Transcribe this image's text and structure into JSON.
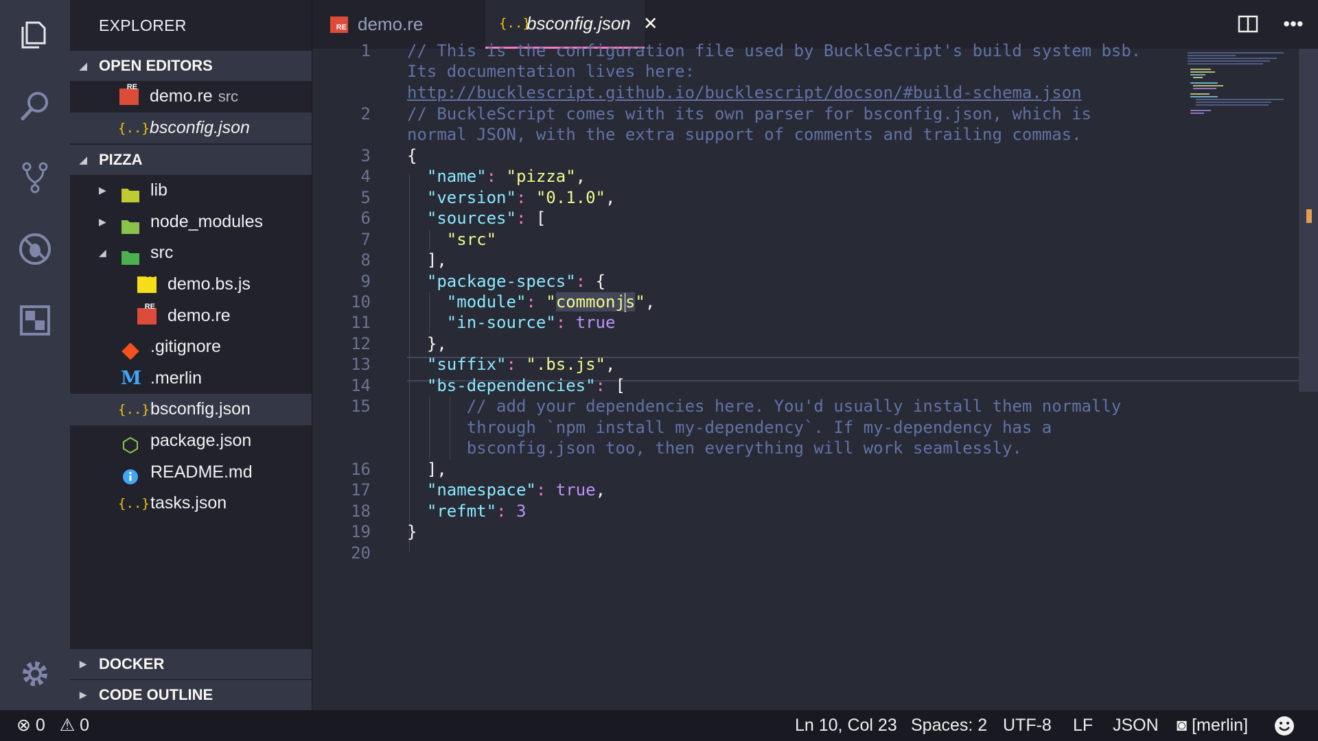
{
  "sidebar": {
    "title": "EXPLORER",
    "open_editors": {
      "label": "OPEN EDITORS",
      "items": [
        {
          "name": "demo.re",
          "sub": "src"
        },
        {
          "name": "bsconfig.json"
        }
      ]
    },
    "project": {
      "label": "PIZZA",
      "items": [
        {
          "name": "lib"
        },
        {
          "name": "node_modules"
        },
        {
          "name": "src"
        },
        {
          "name": "demo.bs.js"
        },
        {
          "name": "demo.re"
        },
        {
          "name": ".gitignore"
        },
        {
          "name": ".merlin"
        },
        {
          "name": "bsconfig.json"
        },
        {
          "name": "package.json"
        },
        {
          "name": "README.md"
        },
        {
          "name": "tasks.json"
        }
      ]
    },
    "docker_label": "DOCKER",
    "outline_label": "CODE OUTLINE"
  },
  "tabs": [
    {
      "label": "demo.re",
      "active": false
    },
    {
      "label": "bsconfig.json",
      "active": true
    }
  ],
  "editor": {
    "line_numbers": [
      "1",
      "2",
      "3",
      "4",
      "5",
      "6",
      "7",
      "8",
      "9",
      "10",
      "11",
      "12",
      "13",
      "14",
      "15",
      "16",
      "17",
      "18",
      "19",
      "20"
    ],
    "code": {
      "l1a": "// This is the configuration file used by BuckleScript's build system bsb.",
      "l1b": "Its documentation lives here:",
      "l1c": "http://bucklescript.github.io/bucklescript/docson/#build-schema.json",
      "l2a": "// BuckleScript comes with its own parser for bsconfig.json, which is",
      "l2b": "normal JSON, with the extra support of comments and trailing commas.",
      "l3": "{",
      "l4k": "\"name\"",
      "l4v": "\"pizza\"",
      "l5k": "\"version\"",
      "l5v": "\"0.1.0\"",
      "l6k": "\"sources\"",
      "l6v": "[",
      "l7v": "\"src\"",
      "l8": "],",
      "l9k": "\"package-specs\"",
      "l9v": "{",
      "l10k": "\"module\"",
      "l10v1": "\"",
      "l10v2": "commonj",
      "l10v3": "s",
      "l10v4": "\"",
      "l11k": "\"in-source\"",
      "l11v": "true",
      "l12": "},",
      "l13k": "\"suffix\"",
      "l13v": "\".bs.js\"",
      "l14k": "\"bs-dependencies\"",
      "l14v": "[",
      "l15a": "// add your dependencies here. You'd usually install them normally",
      "l15b": "through `npm install my-dependency`. If my-dependency has a",
      "l15c": "bsconfig.json too, then everything will work seamlessly.",
      "l16": "],",
      "l17k": "\"namespace\"",
      "l17v": "true",
      "l18k": "\"refmt\"",
      "l18v": "3",
      "l19": "}"
    }
  },
  "status": {
    "errors": "0",
    "warnings": "0",
    "position": "Ln 10, Col 23",
    "spaces": "Spaces: 2",
    "encoding": "UTF-8",
    "eol": "LF",
    "language": "JSON",
    "merlin": "[merlin]"
  },
  "colors": {
    "accent_tab": "#ff79c6",
    "string": "#f1fa8c",
    "key": "#8be9fd",
    "comment": "#6272a4",
    "number_bool": "#bd93f9",
    "punct": "#ff79c6"
  },
  "icons": [
    "files-icon",
    "search-icon",
    "source-control-icon",
    "debug-icon",
    "extensions-icon",
    "settings-gear-icon",
    "split-editor-icon",
    "more-actions-icon",
    "smiley-icon"
  ]
}
